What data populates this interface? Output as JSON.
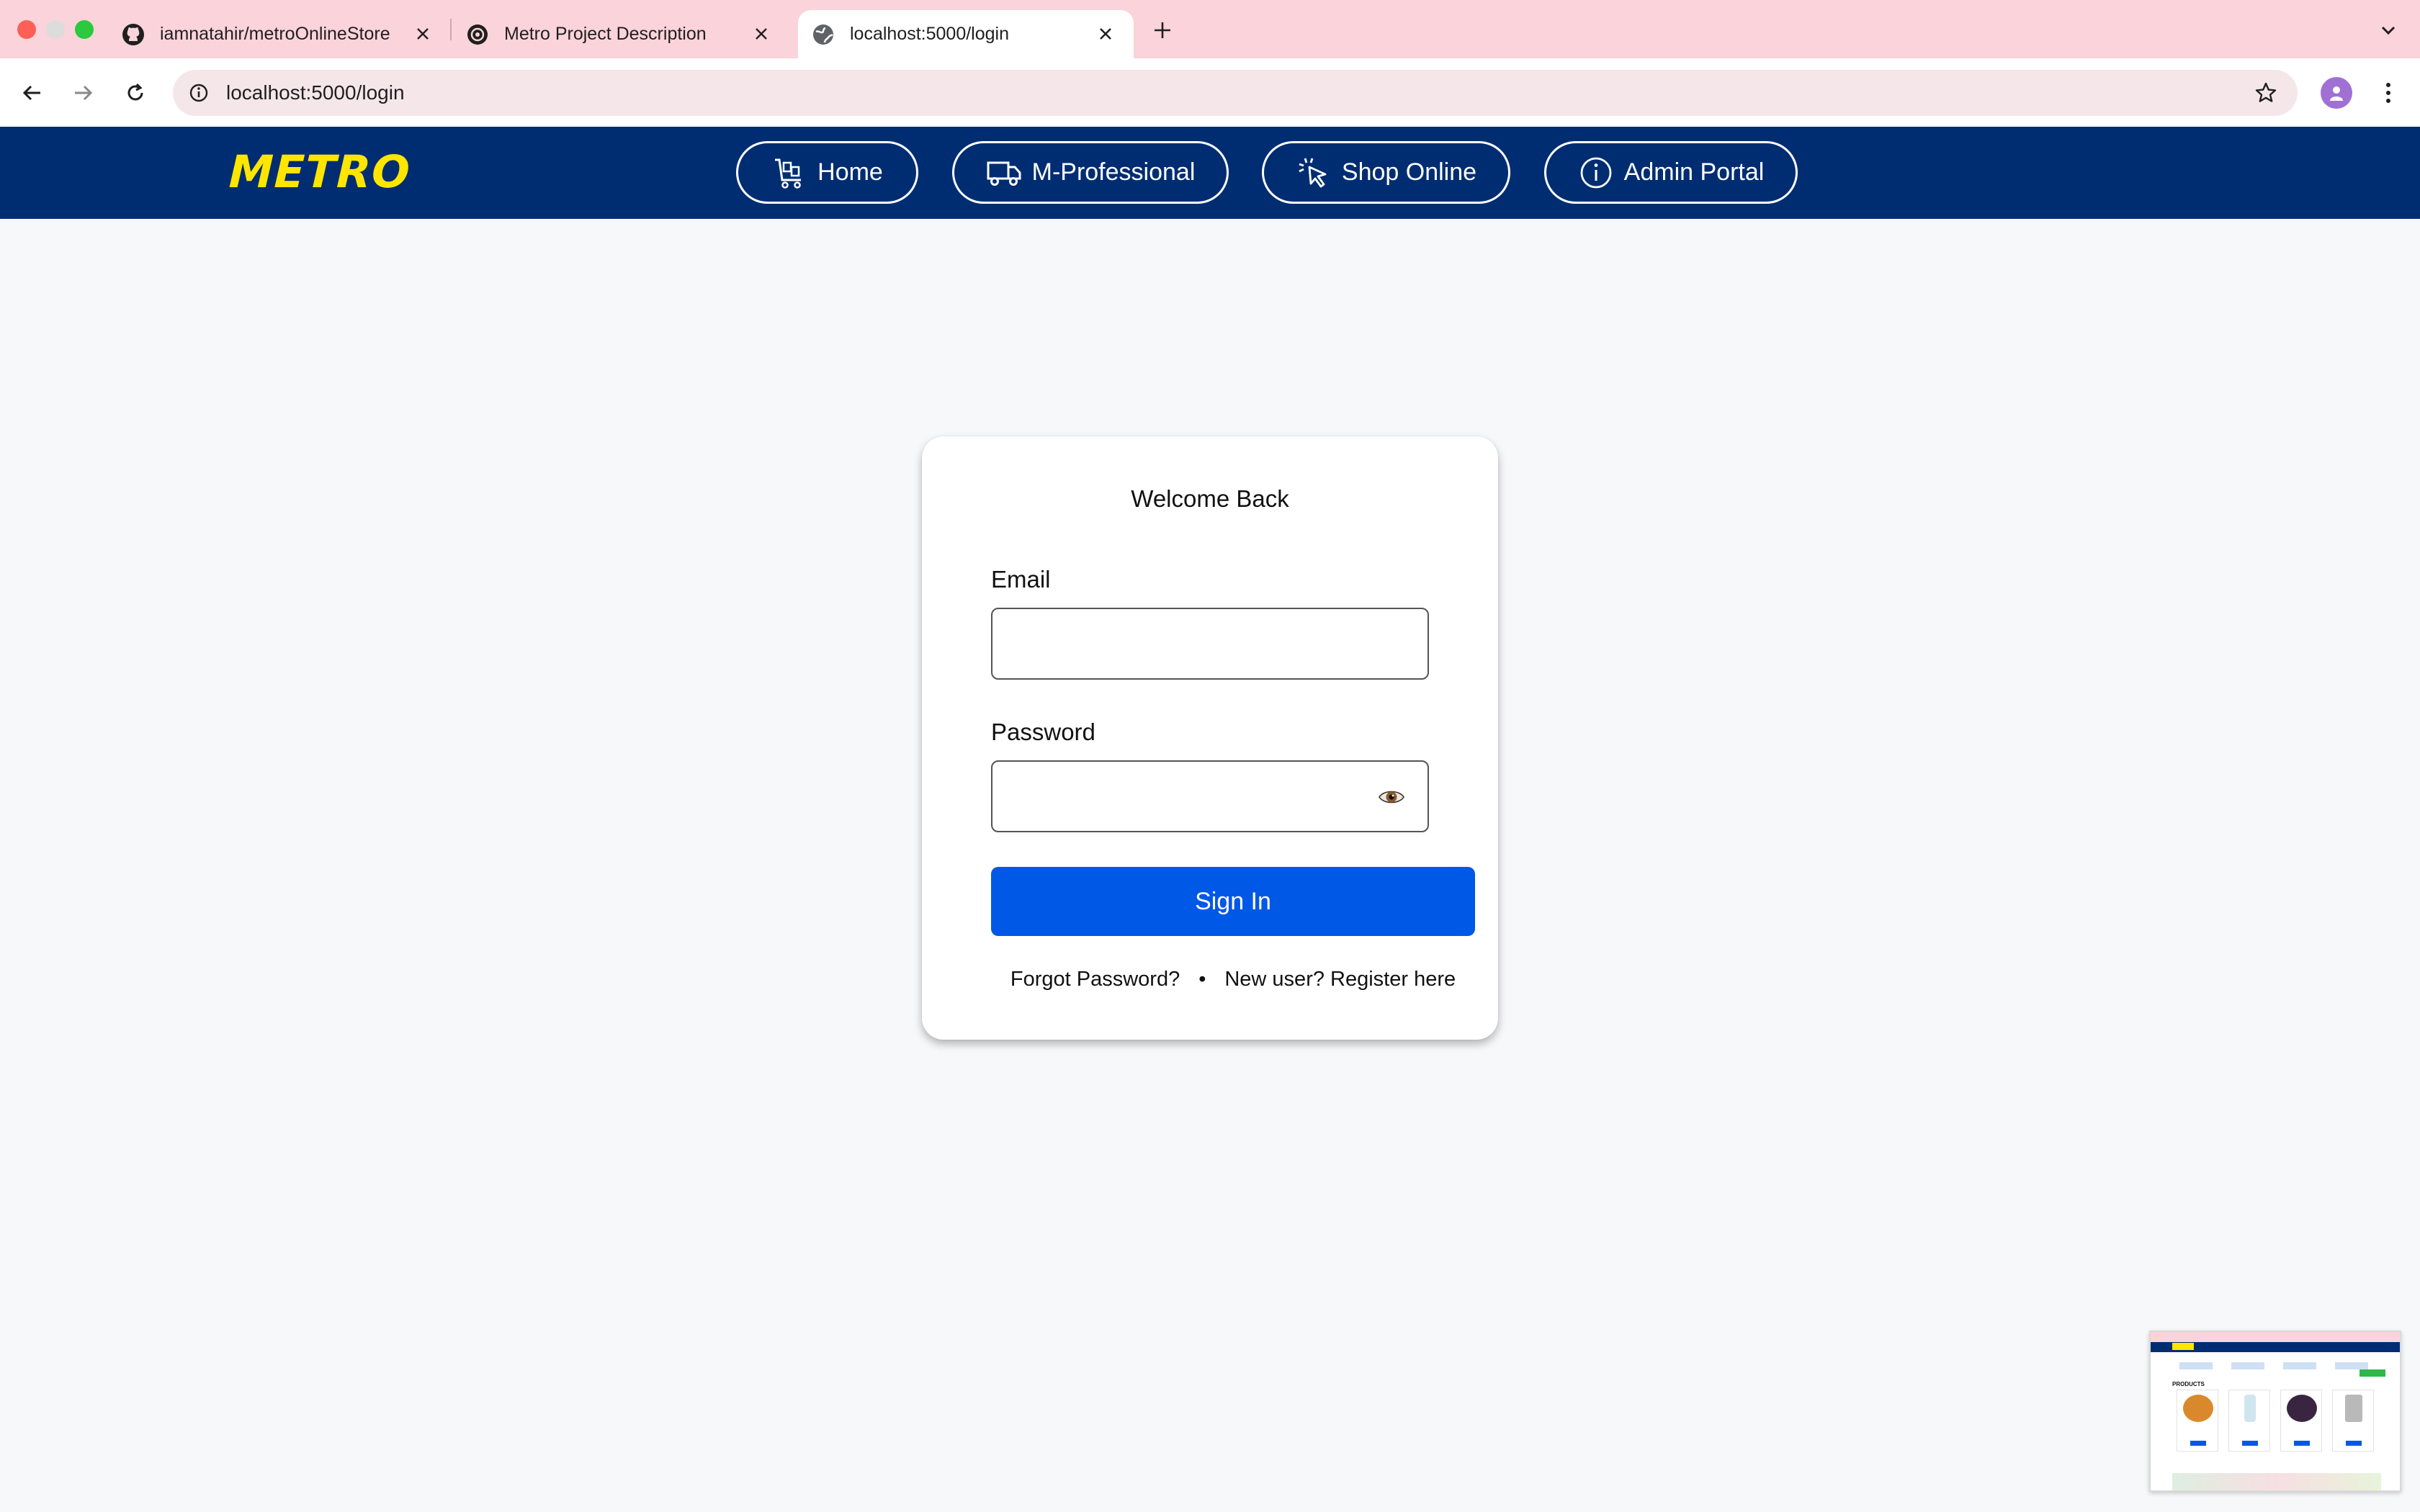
{
  "browser": {
    "tabs": [
      {
        "title": "iamnatahir/metroOnlineStore",
        "icon": "github-icon",
        "active": false
      },
      {
        "title": "Metro Project Description",
        "icon": "openai-icon",
        "active": false
      },
      {
        "title": "localhost:5000/login",
        "icon": "globe-icon",
        "active": true
      }
    ],
    "url": "localhost:5000/login",
    "colors": {
      "tabbar": "#fbd3da",
      "omnibox": "#f5e6ea"
    }
  },
  "header": {
    "logo": "METRO",
    "nav": [
      {
        "label": "Home",
        "icon": "cart-icon"
      },
      {
        "label": "M-Professional",
        "icon": "truck-icon"
      },
      {
        "label": "Shop Online",
        "icon": "click-cursor-icon"
      },
      {
        "label": "Admin Portal",
        "icon": "info-icon"
      }
    ],
    "colors": {
      "background": "#002d72",
      "logo": "#ffe500"
    }
  },
  "login": {
    "title": "Welcome Back",
    "email_label": "Email",
    "email_value": "",
    "password_label": "Password",
    "password_value": "",
    "submit_label": "Sign In",
    "forgot_label": "Forgot Password?",
    "separator": "•",
    "register_label": "New user? Register here",
    "colors": {
      "submit": "#0058e6"
    }
  },
  "preview": {
    "section_title": "PRODUCTS"
  }
}
